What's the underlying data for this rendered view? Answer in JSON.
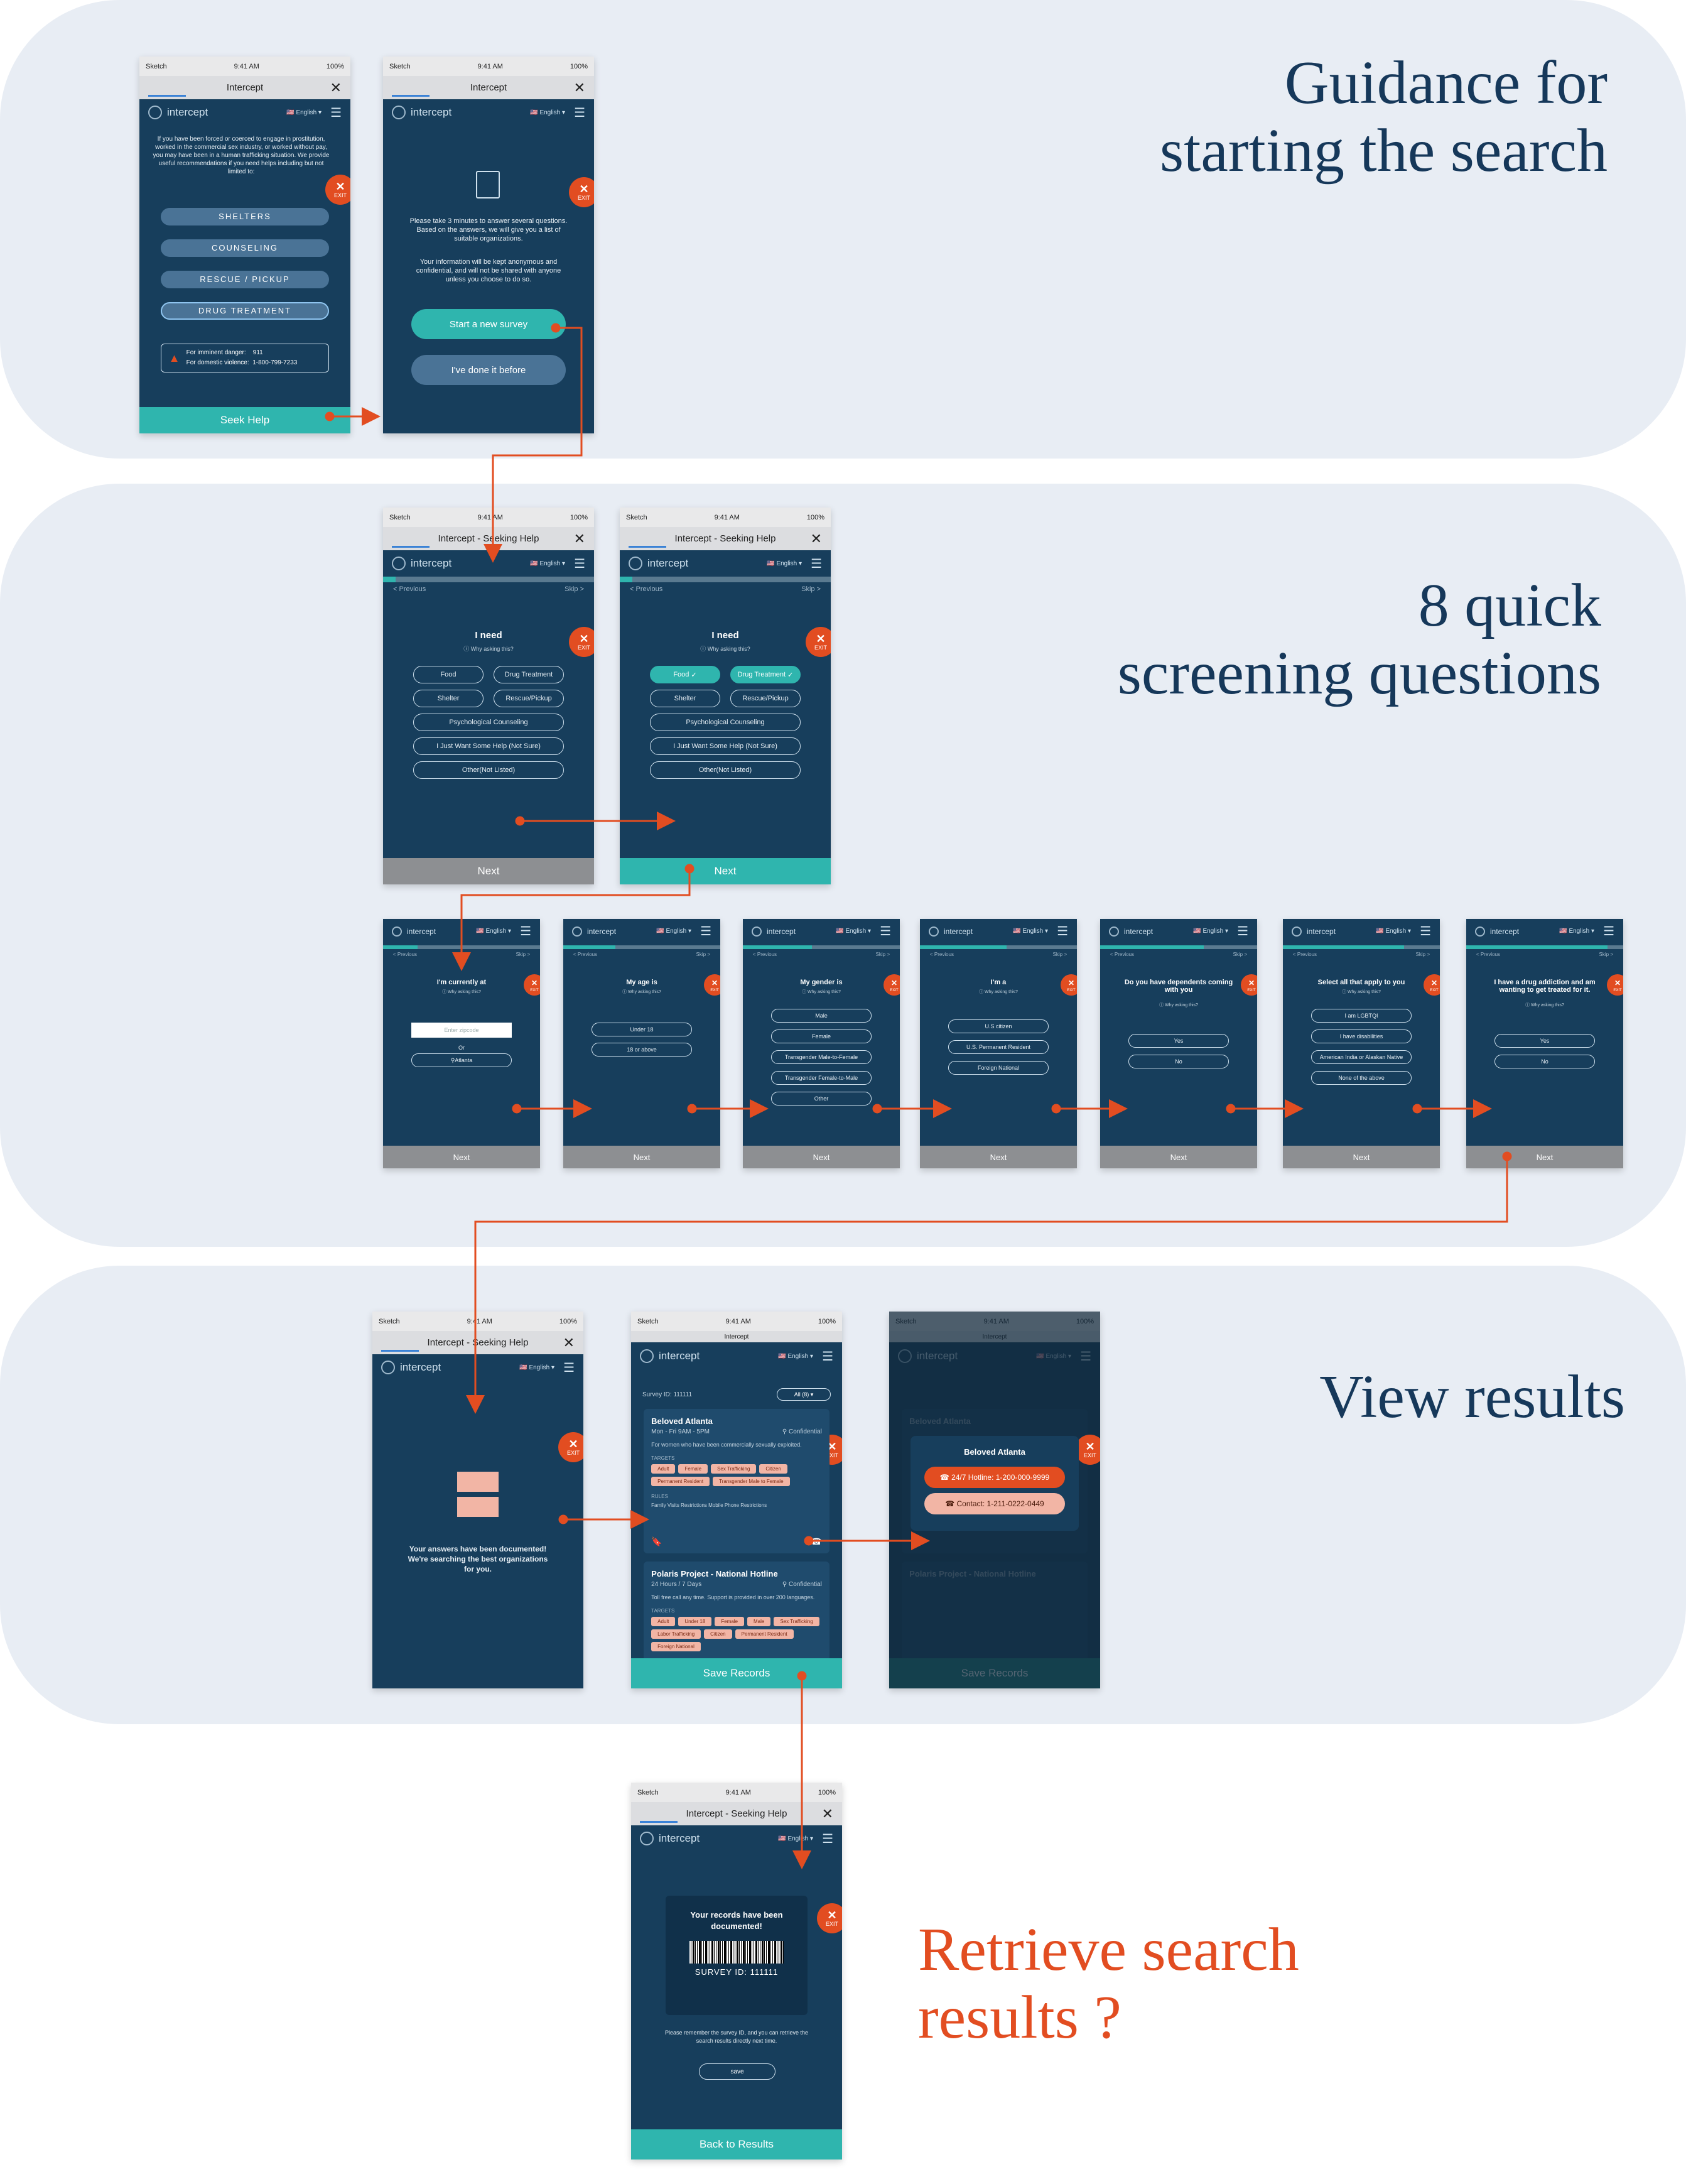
{
  "sections": {
    "guidance": "Guidance for\nstarting the search",
    "screening": "8 quick\nscreening questions",
    "results": "View results",
    "retrieve": "Retrieve search\nresults ?"
  },
  "colors": {
    "accent": "#2fb5ae",
    "exit": "#e24d21",
    "navy": "#173e5c",
    "title": "#16385a"
  },
  "common": {
    "carrier": "Sketch",
    "time": "9:41 AM",
    "battery": "100%",
    "logo_text": "intercept",
    "language": "English",
    "exit_label": "EXIT",
    "previous": "< Previous",
    "skip": "Skip >",
    "why": "Why asking this?",
    "next": "Next"
  },
  "screen1": {
    "url_title": "Intercept",
    "intro": "If you have been forced or coerced to engage in prostitution, worked in the commercial sex industry, or worked without pay, you may have been in a human trafficking situation. We provide useful recommendations if you need helps including but not limited to:",
    "categories": [
      "SHELTERS",
      "COUNSELING",
      "RESCUE / PICKUP",
      "DRUG TREATMENT"
    ],
    "imminent_label": "For imminent danger:",
    "imminent_number": "911",
    "dv_label": "For domestic violence:",
    "dv_number": "1-800-799-7233",
    "cta": "Seek Help"
  },
  "screen2": {
    "url_title": "Intercept",
    "p1": "Please take 3 minutes to answer several questions. Based on the answers, we will give you a list of suitable organizations.",
    "p2": "Your information will be kept anonymous and confidential, and will not be shared with anyone unless you choose to do so.",
    "btn_new": "Start a new survey",
    "btn_before": "I've done it before"
  },
  "need_screen": {
    "url_title": "Intercept - Seeking Help",
    "question": "I need",
    "options": [
      "Food",
      "Drug Treatment",
      "Shelter",
      "Rescue/Pickup",
      "Psychological Counseling",
      "I Just Want Some Help (Not Sure)",
      "Other(Not Listed)"
    ]
  },
  "questions": [
    {
      "q": "I'm currently at",
      "options": [
        "Enter zipcode",
        "Or",
        "Atlanta"
      ]
    },
    {
      "q": "My age is",
      "options": [
        "Under 18",
        "18 or above"
      ]
    },
    {
      "q": "My gender is",
      "options": [
        "Male",
        "Female",
        "Transgender Male-to-Female",
        "Transgender Female-to-Male",
        "Other"
      ]
    },
    {
      "q": "I'm a",
      "options": [
        "U.S citizen",
        "U.S. Permanent Resident",
        "Foreign National"
      ]
    },
    {
      "q": "Do you have dependents coming with you",
      "options": [
        "Yes",
        "No"
      ]
    },
    {
      "q": "Select all that apply to you",
      "options": [
        "I am LGBTQI",
        "I have disabilities",
        "American India or Alaskan Native",
        "None of the above"
      ]
    },
    {
      "q": "I have a drug addiction and am wanting to get treated for it.",
      "options": [
        "Yes",
        "No"
      ]
    }
  ],
  "documented": {
    "url_title": "Intercept - Seeking Help",
    "message": "Your answers have been documented! We're searching the best organizations for you."
  },
  "results": {
    "url_title": "Intercept",
    "survey_id": "Survey ID: 111111",
    "filter": "All (8)",
    "targets_label": "TARGETS",
    "rules_label": "RULES",
    "orgs": [
      {
        "name": "Beloved Atlanta",
        "hours": "Mon - Fri 9AM - 5PM",
        "conf": "Confidential",
        "desc": "For women who have been commercially sexually exploited.",
        "targets": [
          "Adult",
          "Female",
          "Sex Trafficking",
          "Citizen",
          "Permanent Resident",
          "Transgender Male to Female"
        ],
        "rules": "Family Visits Restrictions   Mobile Phone Restrictions"
      },
      {
        "name": "Polaris Project - National Hotline",
        "hours": "24 Hours / 7 Days",
        "conf": "Confidential",
        "desc": "Toll free call any time. Support is provided in over 200 languages.",
        "targets": [
          "Adult",
          "Under 18",
          "Female",
          "Male",
          "Sex Trafficking",
          "Labor Trafficking",
          "Citizen",
          "Permanent Resident",
          "Foreign National"
        ]
      }
    ],
    "save": "Save Records"
  },
  "contact_modal": {
    "title": "Beloved Atlanta",
    "hotline": "24/7 Hotline: 1-200-000-9999",
    "contact": "Contact: 1-211-0222-0449"
  },
  "retrieve": {
    "url_title": "Intercept - Seeking Help",
    "heading": "Your records have been documented!",
    "survey_id": "SURVEY ID: 111111",
    "note": "Please remember the survey ID, and you can retrieve the search results directly next time.",
    "save": "save",
    "back": "Back to Results"
  }
}
